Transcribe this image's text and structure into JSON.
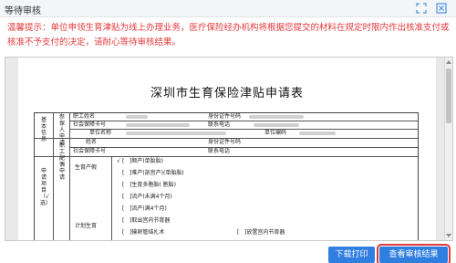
{
  "window": {
    "title": "等待审核"
  },
  "notice": "温馨提示：单位申领生育津贴为线上办理业务，医疗保险经办机构将根据您提交的材料在规定时限内作出核准支付或核准不予支付的决定，请耐心等待审核结果。",
  "document": {
    "title": "深圳市生育保险津贴申请表",
    "section_basic": "基本信息",
    "insured_label": "参保人申请",
    "spouse_label": "职工配偶申请",
    "fields": {
      "name": "职工姓名",
      "id_no": "身份证件号码",
      "social_no": "社会保障卡号",
      "contact": "联系电话",
      "unit_name": "单位名称",
      "unit_code": "单位编码",
      "spouse_name": "姓名",
      "spouse_id": "身份证件号码",
      "spouse_social_no": "社会保障卡号"
    },
    "section_apply": "申请项目（√选）",
    "birth_leave": "生育产假",
    "plan_label": "计划生育",
    "check_mark": "√",
    "options_left": [
      "]顺产(单胎胎)",
      "]难产(剖宫产)(单胎胎)",
      "]生育多胞胎(    胞胎)",
      "]流产(未满4个月)",
      "]流产(满4个月)",
      "]取出宫内节育器",
      "]输卵管结扎术"
    ],
    "options_right": [
      "]放置宫内节育器",
      "]输精管结扎术"
    ]
  },
  "buttons": {
    "download": "下载打印",
    "view_result": "查看审核结果"
  },
  "colors": {
    "notice": "#e4393c",
    "primary": "#2f7fe0",
    "highlight": "#e0393b"
  }
}
